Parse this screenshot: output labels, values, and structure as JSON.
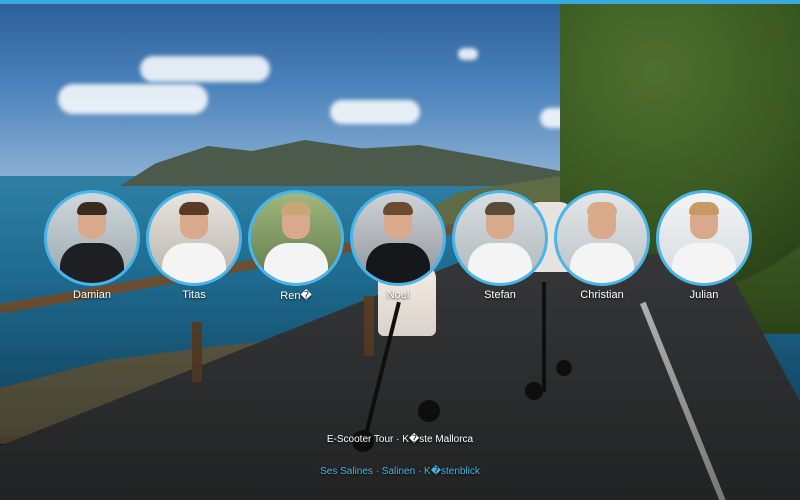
{
  "team": [
    {
      "name": "Damian"
    },
    {
      "name": "Titas"
    },
    {
      "name": "Ren�"
    },
    {
      "name": "Noel"
    },
    {
      "name": "Stefan"
    },
    {
      "name": "Christian"
    },
    {
      "name": "Julian"
    }
  ],
  "caption": {
    "title": "E-Scooter Tour · K�ste Mallorca",
    "subtitle": "Ses Salines · Salinen · K�stenblick"
  },
  "colors": {
    "accent": "#3aa9df",
    "avatar_border": "#48b6ea",
    "subtitle": "#49b3e6"
  }
}
